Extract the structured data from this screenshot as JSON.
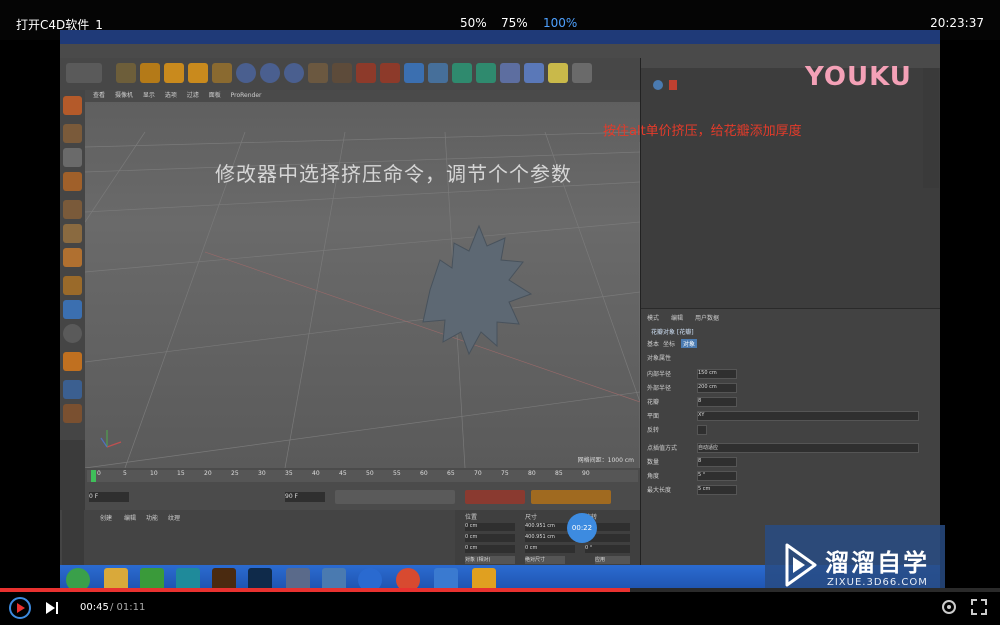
{
  "topbar": {
    "title": "打开C4D软件_1",
    "speeds": [
      "50%",
      "75%",
      "100%"
    ],
    "active_speed_color": "#4ea1ff",
    "clock": "20:23:37"
  },
  "video": {
    "subtitle": "修改器中选择挤压命令，调节个个参数",
    "annotation": "按住alt单价挤压，给花瓣添加厚度",
    "annotation_color": "#e43b2a",
    "brand_logo": "YOUKU",
    "timer_badge": "00:22",
    "viewport_menu": [
      "查看",
      "摄像机",
      "显示",
      "选项",
      "过滤",
      "面板",
      "ProRender"
    ],
    "viewport_info": "网格间距：1000 cm",
    "timeline_ticks": [
      "0",
      "5",
      "10",
      "15",
      "20",
      "25",
      "30",
      "35",
      "40",
      "45",
      "50",
      "55",
      "60",
      "65",
      "70",
      "75",
      "80",
      "85",
      "90"
    ],
    "timeline_start": "0 F",
    "timeline_end": "90 F",
    "bottom_tabs": [
      "创建",
      "编辑",
      "功能",
      "纹理"
    ],
    "coord_headers": [
      "位置",
      "尺寸",
      "旋转"
    ],
    "coords": {
      "position": [
        "0 cm",
        "0 cm",
        "0 cm"
      ],
      "size": [
        "400.951 cm",
        "400.951 cm",
        "0 cm"
      ],
      "rotation": [
        "0 °",
        "0 °",
        "0 °"
      ]
    },
    "coord_buttons": [
      "对象 (相对)",
      "绝对尺寸",
      "应用"
    ],
    "attr_tabs": [
      "模式",
      "编辑",
      "用户数据"
    ],
    "attr_object": "花瓣对象 [花瓣]",
    "attr_subtabs": [
      "基本",
      "坐标",
      "对象"
    ],
    "attr_section": "对象属性",
    "attr_rows": [
      {
        "label": "内部半径",
        "value": "150 cm"
      },
      {
        "label": "外部半径",
        "value": "200 cm"
      },
      {
        "label": "花瓣",
        "value": "8"
      },
      {
        "label": "平面",
        "value": "XY"
      },
      {
        "label": "反转",
        "value": ""
      },
      {
        "label": "点插值方式",
        "value": "自动适应"
      },
      {
        "label": "数量",
        "value": "8"
      },
      {
        "label": "角度",
        "value": "5 °"
      },
      {
        "label": "最大长度",
        "value": "5 cm"
      }
    ]
  },
  "watermark": {
    "title": "溜溜自学",
    "url": "ZIXUE.3D66.COM"
  },
  "player": {
    "current_time": "00:45",
    "total_time": "/ 01:11",
    "progress_percent": 63,
    "progress_color": "#e8312f"
  }
}
